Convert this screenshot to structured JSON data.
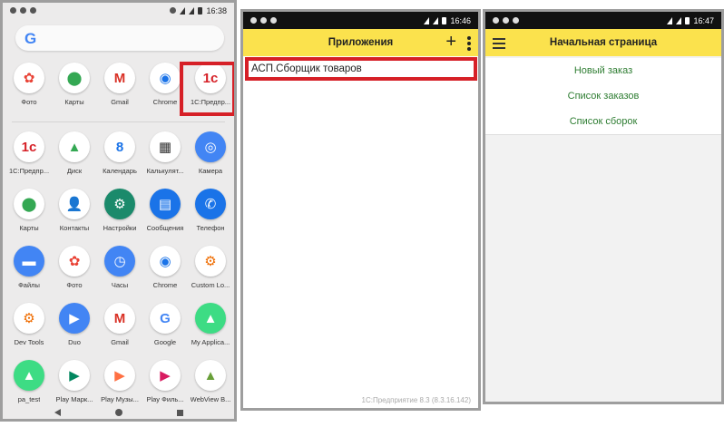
{
  "launcher": {
    "status": {
      "time": "16:38"
    },
    "search_logo": "G",
    "top_row": [
      {
        "label": "Фото",
        "icon": "photos-icon",
        "glyph": "✿",
        "color": "#ffffff",
        "fg": "#e94235"
      },
      {
        "label": "Карты",
        "icon": "maps-icon",
        "glyph": "⬤",
        "color": "#ffffff",
        "fg": "#34a853"
      },
      {
        "label": "Gmail",
        "icon": "gmail-icon",
        "glyph": "M",
        "color": "#ffffff",
        "fg": "#d93025"
      },
      {
        "label": "Chrome",
        "icon": "chrome-icon",
        "glyph": "◉",
        "color": "#ffffff",
        "fg": "#1a73e8"
      },
      {
        "label": "1С:Предпр...",
        "icon": "1c-icon",
        "glyph": "1с",
        "color": "#ffffff",
        "fg": "#d62027"
      }
    ],
    "apps": [
      {
        "label": "1С:Предпр...",
        "icon": "1c-icon",
        "glyph": "1с",
        "color": "#ffffff",
        "fg": "#d62027"
      },
      {
        "label": "Диск",
        "icon": "drive-icon",
        "glyph": "▲",
        "color": "#ffffff",
        "fg": "#34a853"
      },
      {
        "label": "Календарь",
        "icon": "calendar-icon",
        "glyph": "8",
        "color": "#ffffff",
        "fg": "#1a73e8"
      },
      {
        "label": "Калькулят...",
        "icon": "calculator-icon",
        "glyph": "▦",
        "color": "#ffffff",
        "fg": "#333333"
      },
      {
        "label": "Камера",
        "icon": "camera-icon",
        "glyph": "◎",
        "color": "#4285f4",
        "fg": "#ffffff"
      },
      {
        "label": "Карты",
        "icon": "maps-icon",
        "glyph": "⬤",
        "color": "#ffffff",
        "fg": "#34a853"
      },
      {
        "label": "Контакты",
        "icon": "contacts-icon",
        "glyph": "👤",
        "color": "#ffffff",
        "fg": "#1a73e8"
      },
      {
        "label": "Настройки",
        "icon": "settings-icon",
        "glyph": "⚙",
        "color": "#1b8a6b",
        "fg": "#ffffff"
      },
      {
        "label": "Сообщения",
        "icon": "messages-icon",
        "glyph": "▤",
        "color": "#1a73e8",
        "fg": "#ffffff"
      },
      {
        "label": "Телефон",
        "icon": "phone-icon",
        "glyph": "✆",
        "color": "#1a73e8",
        "fg": "#ffffff"
      },
      {
        "label": "Файлы",
        "icon": "files-icon",
        "glyph": "▬",
        "color": "#4285f4",
        "fg": "#ffffff"
      },
      {
        "label": "Фото",
        "icon": "photos-icon",
        "glyph": "✿",
        "color": "#ffffff",
        "fg": "#e94235"
      },
      {
        "label": "Часы",
        "icon": "clock-icon",
        "glyph": "◷",
        "color": "#4285f4",
        "fg": "#ffffff"
      },
      {
        "label": "Chrome",
        "icon": "chrome-icon",
        "glyph": "◉",
        "color": "#ffffff",
        "fg": "#1a73e8"
      },
      {
        "label": "Custom Lo...",
        "icon": "custom-locale-icon",
        "glyph": "⚙",
        "color": "#ffffff",
        "fg": "#ef6c00"
      },
      {
        "label": "Dev Tools",
        "icon": "dev-tools-icon",
        "glyph": "⚙",
        "color": "#ffffff",
        "fg": "#ef6c00"
      },
      {
        "label": "Duo",
        "icon": "duo-icon",
        "glyph": "▶",
        "color": "#4285f4",
        "fg": "#ffffff"
      },
      {
        "label": "Gmail",
        "icon": "gmail-icon",
        "glyph": "M",
        "color": "#ffffff",
        "fg": "#d93025"
      },
      {
        "label": "Google",
        "icon": "google-icon",
        "glyph": "G",
        "color": "#ffffff",
        "fg": "#4285f4"
      },
      {
        "label": "My Applica...",
        "icon": "android-app-icon",
        "glyph": "▲",
        "color": "#3ddc84",
        "fg": "#ffffff"
      },
      {
        "label": "pa_test",
        "icon": "android-app-icon",
        "glyph": "▲",
        "color": "#3ddc84",
        "fg": "#ffffff"
      },
      {
        "label": "Play Марк...",
        "icon": "play-store-icon",
        "glyph": "▶",
        "color": "#ffffff",
        "fg": "#01875f"
      },
      {
        "label": "Play Музы...",
        "icon": "play-music-icon",
        "glyph": "▶",
        "color": "#ffffff",
        "fg": "#ff7043"
      },
      {
        "label": "Play Филь...",
        "icon": "play-movies-icon",
        "glyph": "▶",
        "color": "#ffffff",
        "fg": "#d81b60"
      },
      {
        "label": "WebView B...",
        "icon": "webview-icon",
        "glyph": "▲",
        "color": "#ffffff",
        "fg": "#689f38"
      }
    ]
  },
  "apps_screen": {
    "status": {
      "time": "16:46"
    },
    "title": "Приложения",
    "plus": "+",
    "items": [
      "АСП.Сборщик товаров"
    ],
    "footer": "1С:Предприятие 8.3 (8.3.16.142)"
  },
  "home_screen": {
    "status": {
      "time": "16:47"
    },
    "title": "Начальная страница",
    "menu": [
      "Новый заказ",
      "Список заказов",
      "Список сборок"
    ]
  },
  "colors": {
    "accent_yellow": "#fbe24d",
    "highlight_red": "#d62027",
    "link_green": "#2e7d32"
  }
}
